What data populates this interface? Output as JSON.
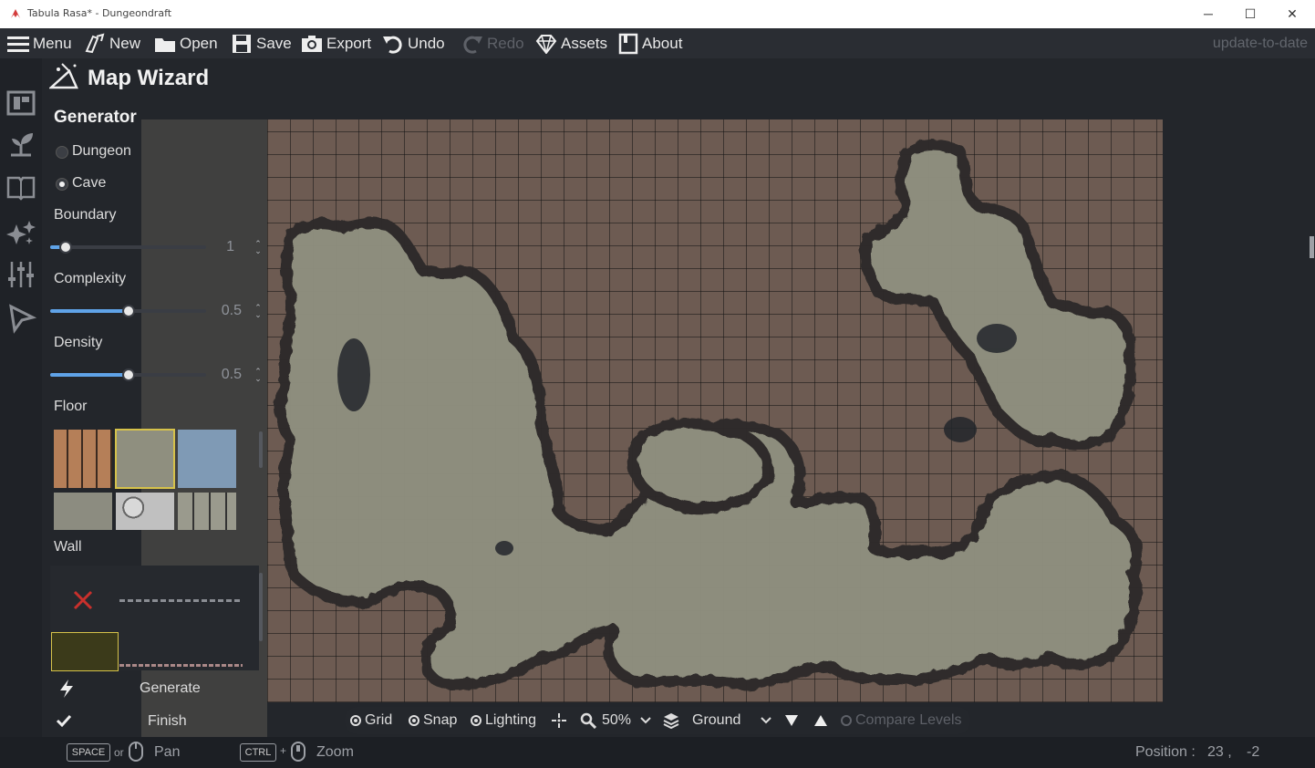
{
  "window": {
    "title": "Tabula Rasa* - Dungeondraft",
    "icon": "dungeondraft-logo-icon",
    "controls": {
      "minimize": "─",
      "maximize": "☐",
      "close": "✕"
    }
  },
  "toolbar": {
    "menu": "Menu",
    "new": "New",
    "open": "Open",
    "save": "Save",
    "export": "Export",
    "undo": "Undo",
    "redo": "Redo",
    "assets": "Assets",
    "about": "About",
    "status": "update-to-date"
  },
  "sidebar_icons": [
    "map-icon",
    "sprout-icon",
    "book-icon",
    "sparkles-icon",
    "sliders-icon",
    "cursor-icon"
  ],
  "wizard": {
    "title": "Map Wizard",
    "generator_label": "Generator",
    "options": {
      "dungeon": "Dungeon",
      "cave": "Cave"
    },
    "selected": "Cave",
    "boundary": {
      "label": "Boundary",
      "value": "1",
      "fraction": 0.1
    },
    "complexity": {
      "label": "Complexity",
      "value": "0.5",
      "fraction": 0.5
    },
    "density": {
      "label": "Density",
      "value": "0.5",
      "fraction": 0.5
    },
    "floor_label": "Floor",
    "wall_label": "Wall",
    "generate": "Generate",
    "finish": "Finish"
  },
  "viewbar": {
    "grid": "Grid",
    "snap": "Snap",
    "lighting": "Lighting",
    "zoom": "50%",
    "level": "Ground",
    "compare": "Compare Levels"
  },
  "statusbar": {
    "space_key": "SPACE",
    "or_text": "or",
    "pan": "Pan",
    "ctrl_key": "CTRL",
    "plus": "+",
    "zoom": "Zoom",
    "position_label": "Position :",
    "position_x": "23 ,",
    "position_y": "-2"
  },
  "colors": {
    "accent": "#5fa3e8",
    "map_background": "#6d5b52",
    "cave_floor": "#8f8f7f",
    "selection_border": "#d6c24a",
    "disabled_x": "#c9302c"
  }
}
